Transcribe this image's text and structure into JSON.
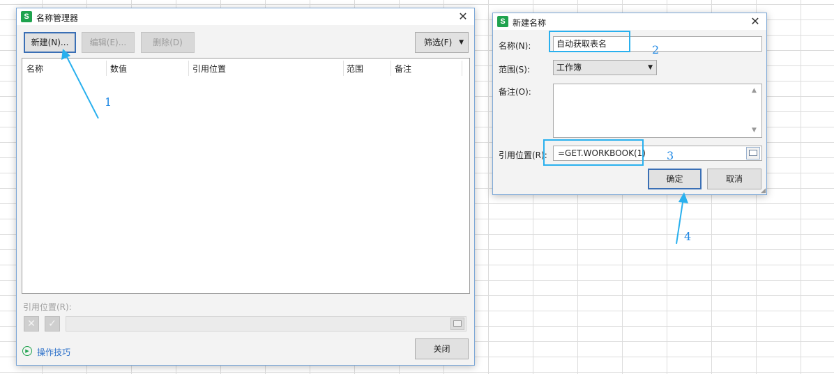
{
  "name_manager": {
    "title": "名称管理器",
    "app_icon_letter": "S",
    "new_button": "新建(N)...",
    "edit_button": "编辑(E)...",
    "delete_button": "删除(D)",
    "filter_button": "筛选(F)",
    "columns": [
      "名称",
      "数值",
      "引用位置",
      "范围",
      "备注"
    ],
    "ref_label": "引用位置(R):",
    "tips_link": "操作技巧",
    "close_button": "关闭"
  },
  "new_name": {
    "title": "新建名称",
    "app_icon_letter": "S",
    "name_label": "名称(N):",
    "name_value": "自动获取表名",
    "scope_label": "范围(S):",
    "scope_value": "工作簿",
    "comment_label": "备注(O):",
    "comment_value": "",
    "ref_label": "引用位置(R):",
    "ref_value": "=GET.WORKBOOK(1)",
    "ok_button": "确定",
    "cancel_button": "取消"
  },
  "annotations": {
    "step1": "1",
    "step2": "2",
    "step3": "3",
    "step4": "4",
    "color": "#29b0ee"
  }
}
